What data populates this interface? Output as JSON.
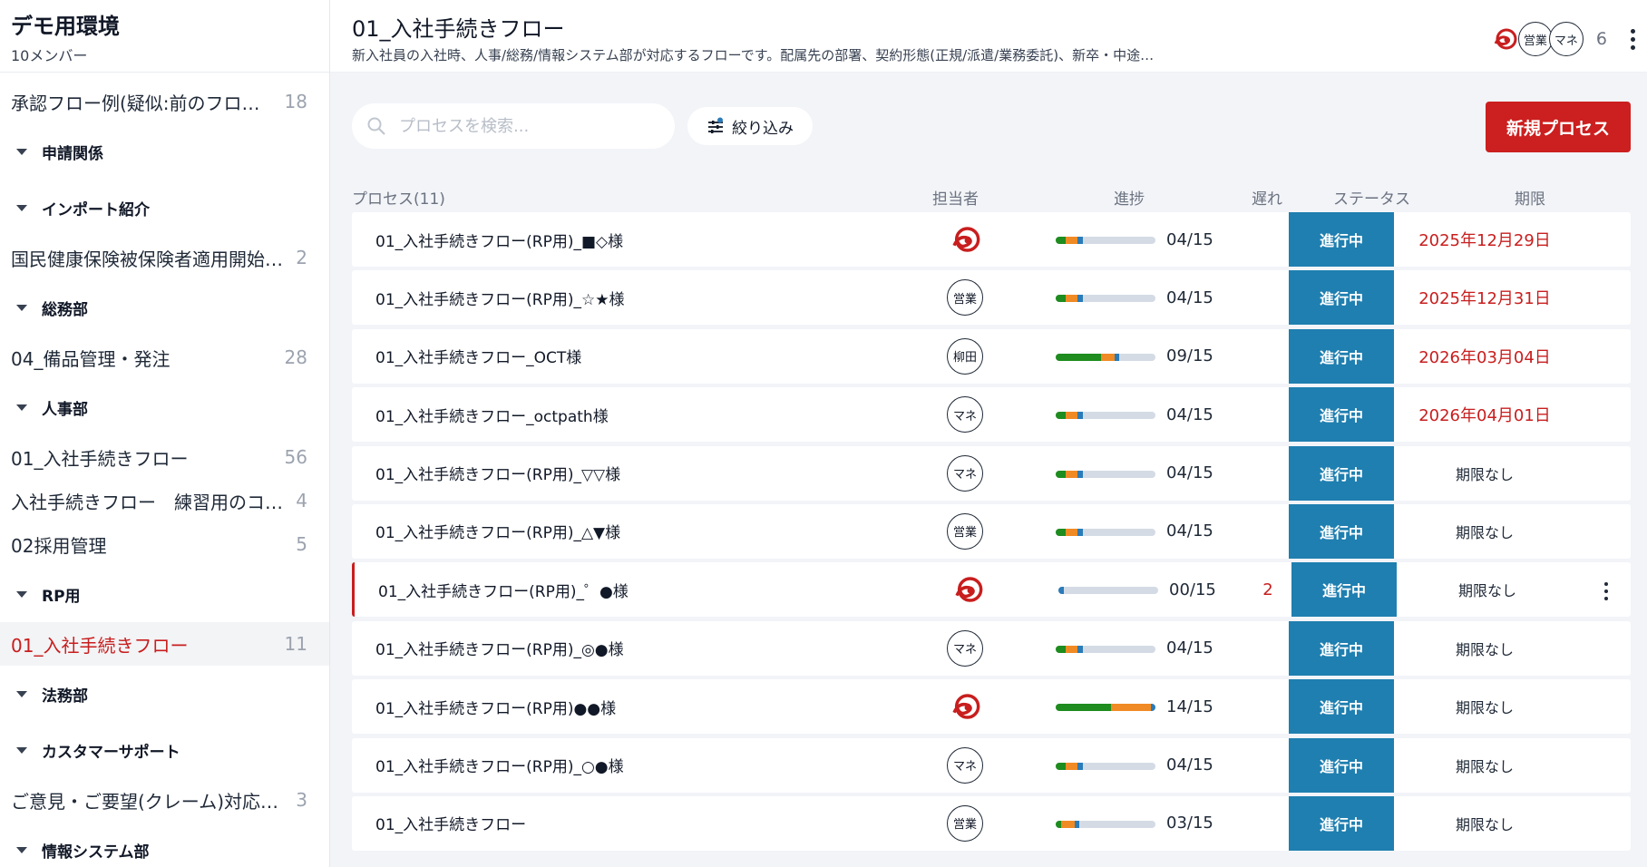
{
  "workspace": {
    "title": "デモ用環境",
    "members": "10メンバー"
  },
  "sidebar": {
    "items": [
      {
        "type": "item",
        "label": "承認フロー例(疑似:前のフロー…",
        "count": "18"
      },
      {
        "type": "group",
        "label": "申請関係"
      },
      {
        "type": "group",
        "label": "インポート紹介"
      },
      {
        "type": "item",
        "label": "国民健康保険被保険者適用開始…",
        "count": "2"
      },
      {
        "type": "group",
        "label": "総務部"
      },
      {
        "type": "item",
        "label": "04_備品管理・発注",
        "count": "28"
      },
      {
        "type": "group",
        "label": "人事部"
      },
      {
        "type": "item",
        "label": "01_入社手続きフロー",
        "count": "56"
      },
      {
        "type": "item",
        "label": "入社手続きフロー　練習用のコピー",
        "count": "4"
      },
      {
        "type": "item",
        "label": "02採用管理",
        "count": "5"
      },
      {
        "type": "group",
        "label": "RP用"
      },
      {
        "type": "item",
        "label": "01_入社手続きフロー",
        "count": "11",
        "active": true
      },
      {
        "type": "group",
        "label": "法務部"
      },
      {
        "type": "group",
        "label": "カスタマーサポート"
      },
      {
        "type": "item",
        "label": "ご意見・ご要望(クレーム)対応フ…",
        "count": "3"
      },
      {
        "type": "group",
        "label": "情報システム部"
      }
    ]
  },
  "header": {
    "title": "01_入社手続きフロー",
    "description": "新入社員の入社時、人事/総務/情報システム部が対応するフローです。配属先の部署、契約形態(正規/派遣/業務委託)、新卒・中途…",
    "avatars": [
      "営業",
      "マネ"
    ],
    "member_count": "6"
  },
  "toolbar": {
    "search_placeholder": "プロセスを検索...",
    "filter_label": "絞り込み",
    "new_button": "新規プロセス"
  },
  "table": {
    "headers": {
      "process": "プロセス(11)",
      "assignee": "担当者",
      "progress": "進捗",
      "late": "遅れ",
      "status": "ステータス",
      "due": "期限"
    },
    "rows": [
      {
        "name": "01_入社手続きフロー(RP用)_■◇様",
        "assignee": "logo",
        "progress": "04/15",
        "fill": {
          "g": 0.1,
          "o": 0.12,
          "b": 0.05
        },
        "late": "",
        "status": "進行中",
        "due": "2025年12月29日",
        "due_red": true
      },
      {
        "name": "01_入社手続きフロー(RP用)_☆★様",
        "assignee": "営業",
        "progress": "04/15",
        "fill": {
          "g": 0.1,
          "o": 0.12,
          "b": 0.05
        },
        "late": "",
        "status": "進行中",
        "due": "2025年12月31日",
        "due_red": true
      },
      {
        "name": "01_入社手続きフロー_OCT様",
        "assignee": "柳田",
        "progress": "09/15",
        "fill": {
          "g": 0.45,
          "o": 0.14,
          "b": 0.05
        },
        "late": "",
        "status": "進行中",
        "due": "2026年03月04日",
        "due_red": true
      },
      {
        "name": "01_入社手続きフロー_octpath様",
        "assignee": "マネ",
        "progress": "04/15",
        "fill": {
          "g": 0.1,
          "o": 0.12,
          "b": 0.05
        },
        "late": "",
        "status": "進行中",
        "due": "2026年04月01日",
        "due_red": true
      },
      {
        "name": "01_入社手続きフロー(RP用)_▽▽様",
        "assignee": "マネ",
        "progress": "04/15",
        "fill": {
          "g": 0.1,
          "o": 0.12,
          "b": 0.05
        },
        "late": "",
        "status": "進行中",
        "due": "期限なし",
        "due_red": false
      },
      {
        "name": "01_入社手続きフロー(RP用)_△▼様",
        "assignee": "営業",
        "progress": "04/15",
        "fill": {
          "g": 0.1,
          "o": 0.12,
          "b": 0.05
        },
        "late": "",
        "status": "進行中",
        "due": "期限なし",
        "due_red": false
      },
      {
        "name": "01_入社手続きフロー(RP用)_゜●様",
        "assignee": "logo",
        "progress": "00/15",
        "fill": {
          "g": 0,
          "o": 0,
          "b": 0.05
        },
        "late": "2",
        "status": "進行中",
        "due": "期限なし",
        "due_red": false,
        "flag": true,
        "more": true
      },
      {
        "name": "01_入社手続きフロー(RP用)_◎●様",
        "assignee": "マネ",
        "progress": "04/15",
        "fill": {
          "g": 0.1,
          "o": 0.12,
          "b": 0.05
        },
        "late": "",
        "status": "進行中",
        "due": "期限なし",
        "due_red": false
      },
      {
        "name": "01_入社手続きフロー(RP用)●●様",
        "assignee": "logo",
        "progress": "14/15",
        "fill": {
          "g": 0.55,
          "o": 0.4,
          "b": 0.05
        },
        "late": "",
        "status": "進行中",
        "due": "期限なし",
        "due_red": false
      },
      {
        "name": "01_入社手続きフロー(RP用)_○●様",
        "assignee": "マネ",
        "progress": "04/15",
        "fill": {
          "g": 0.1,
          "o": 0.12,
          "b": 0.05
        },
        "late": "",
        "status": "進行中",
        "due": "期限なし",
        "due_red": false
      },
      {
        "name": "01_入社手続きフロー",
        "assignee": "営業",
        "progress": "03/15",
        "fill": {
          "g": 0.05,
          "o": 0.14,
          "b": 0.05
        },
        "late": "",
        "status": "進行中",
        "due": "期限なし",
        "due_red": false
      }
    ]
  },
  "colors": {
    "accent_red": "#cc1f1f",
    "status_blue": "#1f7fb0",
    "bar_green": "#1e8c1e",
    "bar_orange": "#f08a24",
    "bar_blue": "#2a7bb8"
  }
}
